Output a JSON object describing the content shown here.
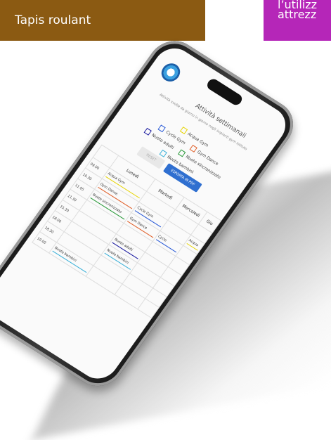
{
  "banner_left": "Tapis roulant",
  "banner_right": {
    "line1": "l’utilizz",
    "line2": "attrezz"
  },
  "app": {
    "title": "Attività settimanali",
    "subtitle": "Attività svolte da giorno in giorno negli impianti gym Istituto",
    "legend": [
      {
        "label": "Acqua Gym",
        "color": "#e6d400"
      },
      {
        "label": "Cycle Gym",
        "color": "#2a5bd7"
      },
      {
        "label": "Gym Dance",
        "color": "#e0602a"
      },
      {
        "label": "Nuoto adulti",
        "color": "#1a1aa0"
      },
      {
        "label": "Nuoto sincronizzato",
        "color": "#2a9a3a"
      },
      {
        "label": "Nuoto bambini",
        "color": "#3ab0d8"
      }
    ],
    "reset_label": "RESET",
    "pdf_label": "ESPORTA IN PDF",
    "days": [
      "Lunedì",
      "Martedì",
      "Mercoledì",
      "Gio"
    ],
    "times": [
      "09.00",
      "10.30",
      "11.05",
      "11.30",
      "15.30",
      "18.00",
      "18.30",
      "19.00"
    ],
    "events": {
      "r0c0": "Acqua Gym",
      "r1c0": "Gym Dance",
      "r1c1": "Cycle Gym",
      "r1c3": "Acqua",
      "r2c0": "Nuoto sincronizzato",
      "r2c1": "Gym Dance",
      "r2c2": "Cycle",
      "r4c1": "Nuoto adulti",
      "r5c1": "Nuoto bambini",
      "r7c0": "Nuoto bambini"
    }
  },
  "colors": {
    "banner_left_bg": "#8b5a12",
    "banner_right_bg": "#b526b8",
    "pdf_button": "#2f6fd0"
  }
}
